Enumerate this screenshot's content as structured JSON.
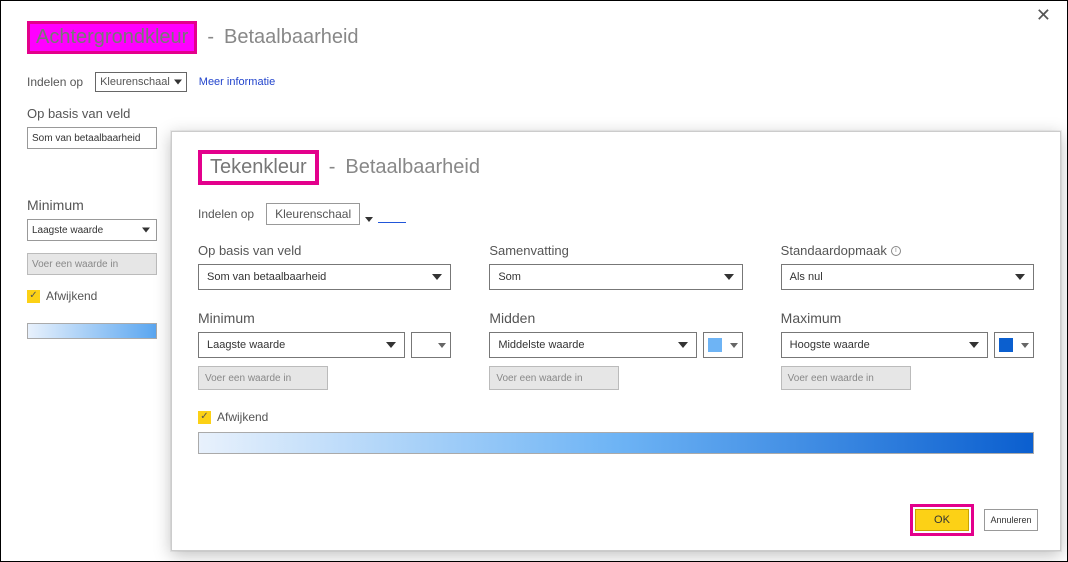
{
  "back": {
    "title": "Achtergrondkleur",
    "subtitle": "Betaalbaarheid",
    "indelen_label": "Indelen op",
    "indelen_value": "Kleurenschaal",
    "meer_info": "Meer informatie",
    "basis_label": "Op basis van veld",
    "basis_value": "Som van betaalbaarheid",
    "minimum_label": "Minimum",
    "minimum_value": "Laagste waarde",
    "value_placeholder": "Voer een waarde in",
    "afwijkend_label": "Afwijkend"
  },
  "front": {
    "title": "Tekenkleur",
    "subtitle": "Betaalbaarheid",
    "indelen_label": "Indelen op",
    "indelen_value": "Kleurenschaal",
    "basis_label": "Op basis van veld",
    "basis_value": "Som van betaalbaarheid",
    "samen_label": "Samenvatting",
    "samen_value": "Som",
    "std_label": "Standaardopmaak",
    "std_value": "Als nul",
    "min_label": "Minimum",
    "min_value": "Laagste waarde",
    "mid_label": "Midden",
    "mid_value": "Middelste waarde",
    "max_label": "Maximum",
    "max_value": "Hoogste waarde",
    "value_placeholder": "Voer een waarde in",
    "afwijkend_label": "Afwijkend",
    "ok": "OK",
    "cancel": "Annuleren",
    "colors": {
      "min": "#6eb4f5",
      "mid": "#6eb4f5",
      "max": "#0b5fcf"
    }
  }
}
